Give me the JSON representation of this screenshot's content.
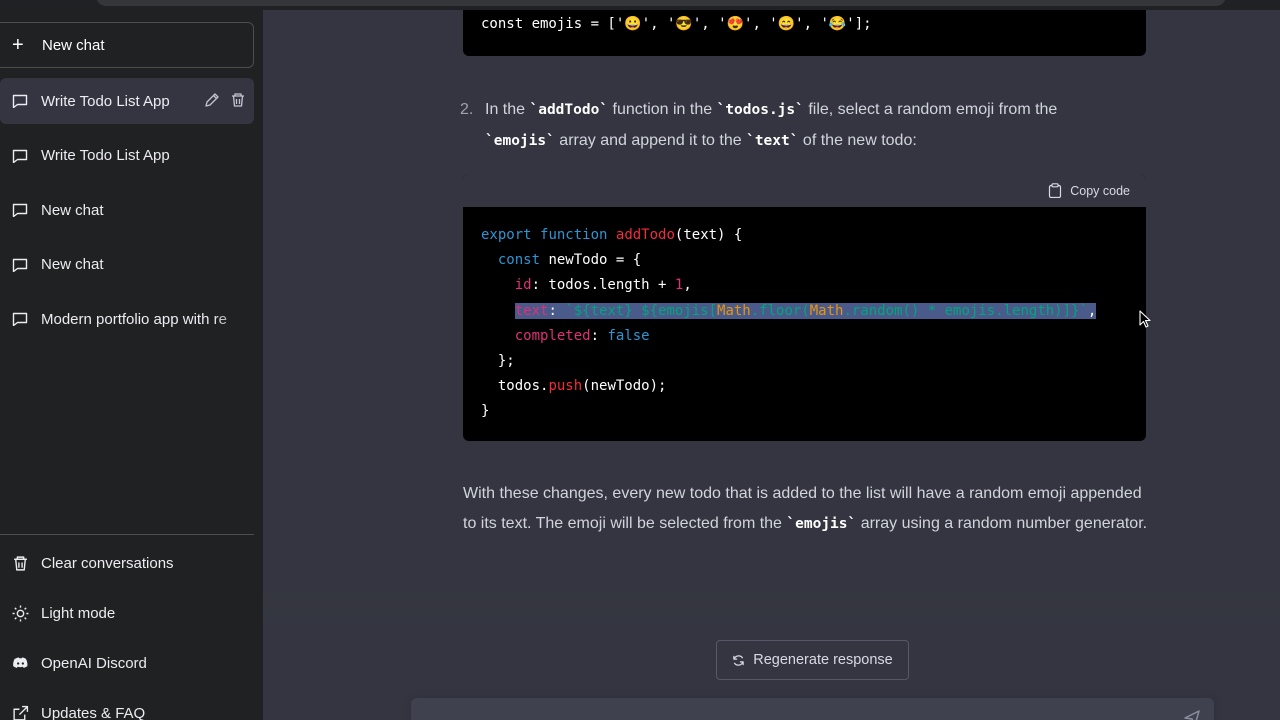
{
  "sidebar": {
    "new_chat_label": "New chat",
    "conversations": [
      {
        "label": "Write Todo List App"
      },
      {
        "label": "Write Todo List App"
      },
      {
        "label": "New chat"
      },
      {
        "label": "New chat"
      },
      {
        "label": "Modern portfolio app with re"
      }
    ],
    "bottom": [
      {
        "label": "Clear conversations",
        "icon": "trash-icon"
      },
      {
        "label": "Light mode",
        "icon": "sun-icon"
      },
      {
        "label": "OpenAI Discord",
        "icon": "discord-icon"
      },
      {
        "label": "Updates & FAQ",
        "icon": "external-link-icon"
      }
    ]
  },
  "main": {
    "top_code": "const emojis = ['😀', '😎', '😍', '😄', '😂'];",
    "step": {
      "number": "2.",
      "t1": "In the ",
      "c1": "`addTodo`",
      "t2": " function in the ",
      "c2": "`todos.js`",
      "t3": " file, select a random emoji from the ",
      "c3": "`emojis`",
      "t4": " array and append it to the ",
      "c4": "`text`",
      "t5": " of the new todo:"
    },
    "copy_label": "Copy code",
    "code_lines": {
      "l1_kw1": "export",
      "l1_kw2": "function",
      "l1_fn": "addTodo",
      "l1_rest": "(text) {",
      "l2_kw": "const",
      "l2_rest": " newTodo = {",
      "l3_prop": "id",
      "l3_mid": ": todos.length + ",
      "l3_num": "1",
      "l3_end": ",",
      "l4_prop": "text",
      "l4_colon": ": ",
      "l4_str1": "`${text} ${emojis[",
      "l4_cls1": "Math",
      "l4_str2": ".floor(",
      "l4_cls2": "Math",
      "l4_str3": ".random() * emojis.length)]}`",
      "l4_end": ",",
      "l5_prop": "completed",
      "l5_colon": ": ",
      "l5_kw": "false",
      "l6": "};",
      "l7_a": "todos.",
      "l7_fn": "push",
      "l7_b": "(newTodo);",
      "l8": "}"
    },
    "para": {
      "t1": "With these changes, every new todo that is added to the list will have a random emoji appended to its text. The emoji will be selected from the ",
      "c1": "`emojis`",
      "t2": " array using a random number generator."
    },
    "regenerate_label": "Regenerate response"
  }
}
